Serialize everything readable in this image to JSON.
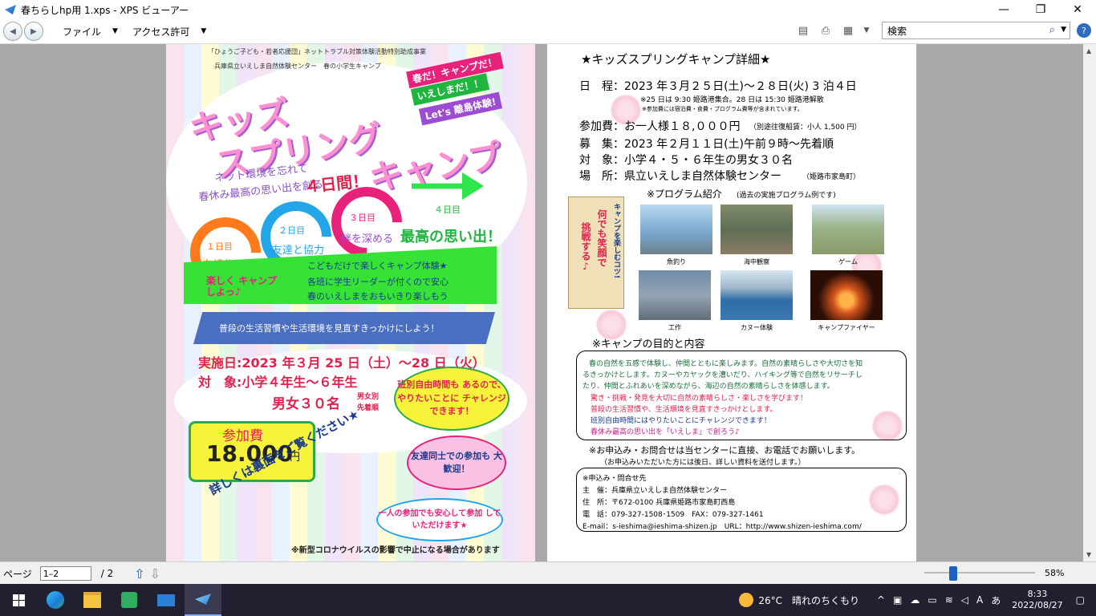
{
  "window": {
    "title": "春ちらしhp用 1.xps - XPS ビューアー",
    "minimize": "—",
    "maximize": "❐",
    "close": "✕"
  },
  "toolbar": {
    "file_menu": "ファイル",
    "access_menu": "アクセス許可",
    "search_placeholder": "検索",
    "help": "?"
  },
  "flyer": {
    "header_line1": "「ひょうご子ども・若者応援団」ネットトラブル対策体験活動特別助成事業",
    "header_line2": "兵庫県立いえしま自然体験センター　春の小学生キャンプ",
    "title_kids": "キッズ",
    "title_spring": "スプリング",
    "title_camp": "キャンプ",
    "tag1": "春だ！キャンプだ！",
    "tag2": "いえしまだ！！",
    "tag3": "Let's 離島体験!",
    "sub1": "ネット環境を忘れて",
    "sub2": "春休み最高の思い出を創る",
    "four_days": "４日間！",
    "days": [
      {
        "label": "１日目",
        "caption": "友達作り"
      },
      {
        "label": "２日目",
        "caption": "友達と協力"
      },
      {
        "label": "３日目",
        "caption": "絆を深める"
      },
      {
        "label": "４日目",
        "caption": "最高の思い出！"
      }
    ],
    "banner_left": "楽しく キャンプ しよっ♪",
    "banner_lines": [
      "こどもだけで楽しくキャンプ体験★",
      "各班に学生リーダーが付くので安心",
      "春のいえしまをおもいきり楽しもう"
    ],
    "blue_banner": "普段の生活習慣や生活環境を見直すきっかけにしよう！",
    "date": "実施日:2023 年３月 25 日（土）～28 日（火）",
    "target": "対　象:小学４年生～６年生",
    "quota": "男女３０名",
    "quota_note1": "男女別",
    "quota_note2": "先着順",
    "fee_label": "参加費",
    "fee_value": "18.000",
    "fee_unit": "円",
    "bubble1": "班別自由時間も あるので、やりたいことに チャレンジできます！",
    "bubble2": "友達同士での参加も 大歓迎！",
    "bubble3": "一人の参加でも安心して参加 していただけます★",
    "back_note": "詳しくは裏面をご覧ください★",
    "footer_note": "※新型コロナウイルスの影響で中止になる場合があります"
  },
  "detail": {
    "title": "★キッズスプリングキャンプ詳細★",
    "schedule": "日　程：2023 年３月２５日(土)～２８日(火) 3 泊４日",
    "schedule_note1": "※25 日は 9:30 姫路港集合。28 日は 15:30 姫路港解散",
    "schedule_note2": "※参加費には宿泊費・食費・プログラム費等が含まれています。",
    "fee": "参加費：お一人様１８,０００円",
    "fee_note": "（別途往復船賃：小人 1,500 円）",
    "recruit": "募　集：2023 年２月１１日(土)午前９時～先着順",
    "target": "対　象：小学４・５・６年生の男女３０名",
    "place": "場　所：県立いえしま自然体験センター",
    "place_note": "（姫路市家島町）",
    "program_title": "※プログラム紹介",
    "program_note": "(過去の実施プログラム例です)",
    "scroll_text1": "キャンプを楽しむコツ!",
    "scroll_text2": "何でも笑顔で",
    "scroll_text3": "挑戦する♪",
    "photos": [
      {
        "caption": "魚釣り"
      },
      {
        "caption": "海中観察"
      },
      {
        "caption": "ゲーム"
      },
      {
        "caption": "工作"
      },
      {
        "caption": "カヌー体験"
      },
      {
        "caption": "キャンプファイヤー"
      }
    ],
    "purpose_title": "※キャンプの目的と内容",
    "purpose_lines": [
      "春の自然を五感で体験し、仲間とともに楽しみます。自然の素晴らしさや大切さを知",
      "るきっかけとします。カヌーやカヤックを漕いだり、ハイキング等で自然をリサーチし",
      "たり、仲間とふれあいを深めながら、海辺の自然の素晴らしさを体感します。"
    ],
    "purpose_red1": "驚き・挑戦・発見を大切に自然の素晴らしさ・楽しさを学びます！",
    "purpose_red2": "普段の生活習慣や、生活環境を見直すきっかけとします。",
    "purpose_blue": "班別自由時間にはやりたいことにチャレンジできます！",
    "purpose_pink": "春休み最高の思い出を「いえしま」で創ろう♪",
    "apply1": "※お申込み・お問合せは当センターに直接、お電話でお願いします。",
    "apply2": "（お申込みいただいた方には後日、詳しい資料を送付します。）",
    "contact_title": "※申込み・問合せ先",
    "contact_host": "主　催：兵庫県立いえしま自然体験センター",
    "contact_addr": "住　所：〒672-0100 兵庫県姫路市家島町西島",
    "contact_tel": "電　話：079-327-1508･1509　FAX：079-327-1461",
    "contact_web": "E-mail：s-ieshima@ieshima-shizen.jp　URL：http://www.shizen-ieshima.com/"
  },
  "status": {
    "page_label": "ページ",
    "page_value": "1–2",
    "page_total": "/ 2",
    "zoom": "58%"
  },
  "taskbar": {
    "weather": "26°C　晴れのちくもり",
    "time": "8:33",
    "date": "2022/08/27"
  },
  "colors": {
    "accent_blue": "#1e5fc2",
    "flyer_pink": "#ff8fd0",
    "flyer_green": "#35e235",
    "flyer_red": "#e0234e"
  }
}
